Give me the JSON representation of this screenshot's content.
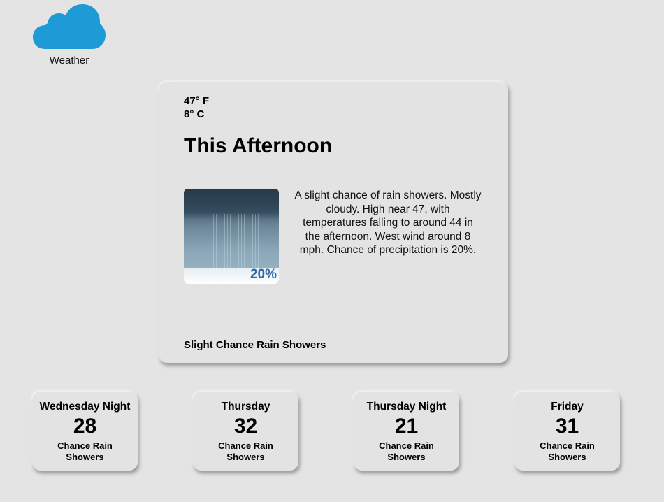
{
  "app": {
    "label": "Weather",
    "icon": "cloud-icon",
    "icon_color": "#1e9ad6"
  },
  "current": {
    "temp_f": "47° F",
    "temp_c": "8° C",
    "period": "This Afternoon",
    "image_pop": "20%",
    "detailed_forecast": "A slight chance of rain showers. Mostly cloudy. High near 47, with temperatures falling to around 44 in the afternoon. West wind around 8 mph. Chance of precipitation is 20%.",
    "short_forecast": "Slight Chance Rain Showers"
  },
  "forecast": [
    {
      "name": "Wednesday Night",
      "temp": "28",
      "desc": "Chance Rain Showers"
    },
    {
      "name": "Thursday",
      "temp": "32",
      "desc": "Chance Rain Showers"
    },
    {
      "name": "Thursday Night",
      "temp": "21",
      "desc": "Chance Rain Showers"
    },
    {
      "name": "Friday",
      "temp": "31",
      "desc": "Chance Rain Showers"
    }
  ]
}
